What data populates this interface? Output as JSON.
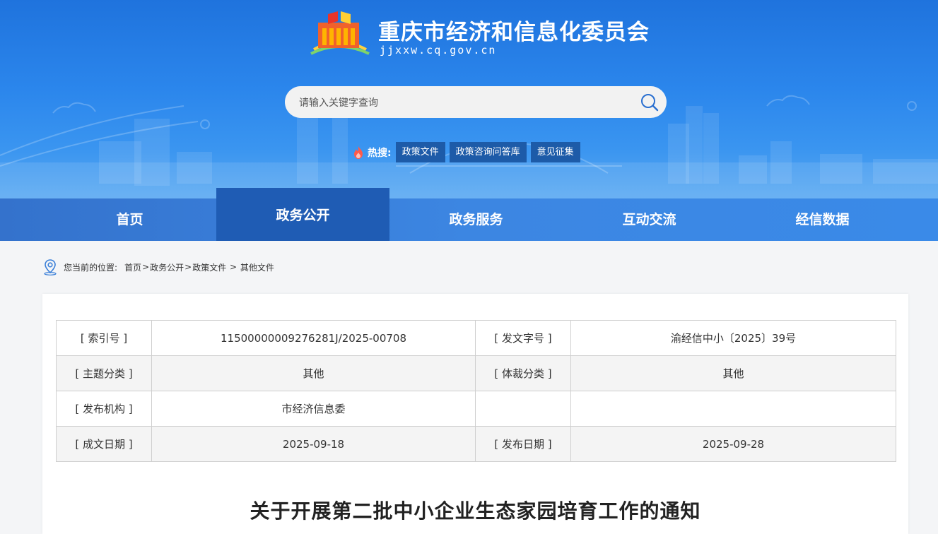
{
  "header": {
    "site_title": "重庆市经济和信息化委员会",
    "site_domain": "jjxxw.cq.gov.cn",
    "search_placeholder": "请输入关键字查询",
    "hot_label": "热搜:",
    "hot_tags": [
      "政策文件",
      "政策咨询问答库",
      "意见征集"
    ]
  },
  "nav": {
    "items": [
      "首页",
      "政务公开",
      "政务服务",
      "互动交流",
      "经信数据"
    ],
    "active_index": 1
  },
  "breadcrumb": {
    "prefix": "您当前的位置:",
    "items": [
      "首页",
      "政务公开",
      "政策文件",
      "其他文件"
    ],
    "separators": [
      ">",
      ">",
      " > "
    ]
  },
  "meta_table": {
    "rows": [
      {
        "l1": "[ 索引号 ]",
        "v1": "11500000009276281J/2025-00708",
        "l2": "[ 发文字号 ]",
        "v2": "渝经信中小〔2025〕39号"
      },
      {
        "l1": "[ 主题分类 ]",
        "v1": "其他",
        "l2": "[ 体裁分类 ]",
        "v2": "其他"
      },
      {
        "l1": "[ 发布机构 ]",
        "v1": "市经济信息委",
        "l2": "",
        "v2": ""
      },
      {
        "l1": "[ 成文日期 ]",
        "v1": "2025-09-18",
        "l2": "[ 发布日期 ]",
        "v2": "2025-09-28"
      }
    ]
  },
  "document": {
    "title": "关于开展第二批中小企业生态家园培育工作的通知"
  },
  "colors": {
    "banner_top": "#1f73dd",
    "nav_active": "#1f5cb4",
    "hot_tag_bg": "#1d5ba8"
  }
}
